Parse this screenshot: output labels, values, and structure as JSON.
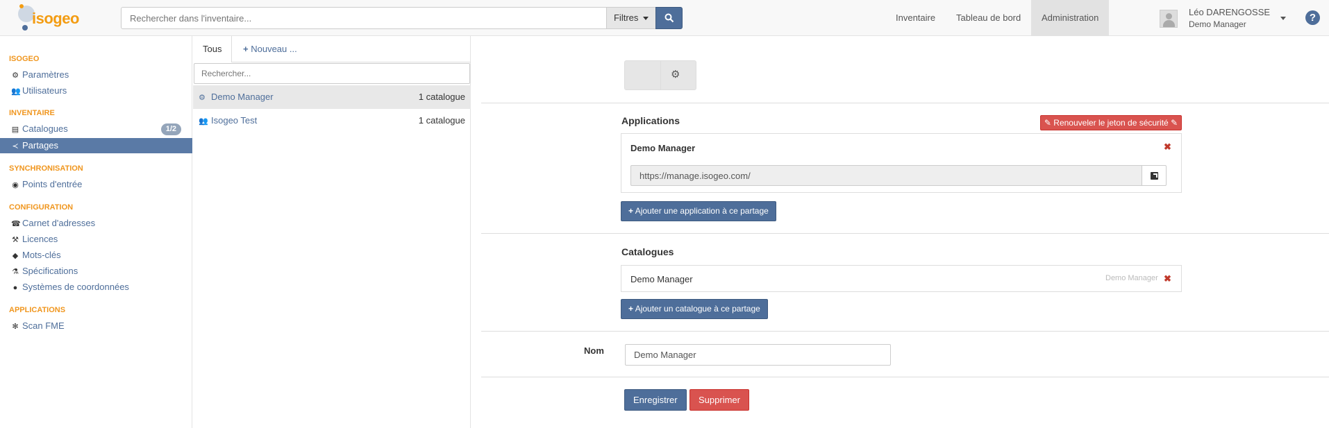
{
  "brand": {
    "logo_text": "isogeo"
  },
  "header": {
    "search_placeholder": "Rechercher dans l'inventaire...",
    "filters_label": "Filtres",
    "nav": [
      {
        "label": "Inventaire"
      },
      {
        "label": "Tableau de bord"
      },
      {
        "label": "Administration",
        "active": true
      }
    ],
    "user": {
      "name": "Léo DARENGOSSE",
      "org": "Demo Manager"
    },
    "help_label": "?"
  },
  "sidebar": {
    "sections": [
      {
        "title": "ISOGEO",
        "items": [
          {
            "label": "Paramètres",
            "icon": "gears-icon"
          },
          {
            "label": "Utilisateurs",
            "icon": "users-icon"
          }
        ]
      },
      {
        "title": "INVENTAIRE",
        "items": [
          {
            "label": "Catalogues",
            "icon": "book-icon",
            "badge": "1/2"
          },
          {
            "label": "Partages",
            "icon": "share-icon",
            "active": true
          }
        ]
      },
      {
        "title": "SYNCHRONISATION",
        "items": [
          {
            "label": "Points d'entrée",
            "icon": "eye-icon"
          }
        ]
      },
      {
        "title": "CONFIGURATION",
        "items": [
          {
            "label": "Carnet d'adresses",
            "icon": "phone-icon"
          },
          {
            "label": "Licences",
            "icon": "gavel-icon"
          },
          {
            "label": "Mots-clés",
            "icon": "tags-icon"
          },
          {
            "label": "Spécifications",
            "icon": "flask-icon"
          },
          {
            "label": "Systèmes de coordonnées",
            "icon": "globe-icon"
          }
        ]
      },
      {
        "title": "APPLICATIONS",
        "items": [
          {
            "label": "Scan FME",
            "icon": "gear-icon"
          }
        ]
      }
    ]
  },
  "shares_panel": {
    "tabs": {
      "all": "Tous",
      "new": "Nouveau ..."
    },
    "search_placeholder": "Rechercher...",
    "items": [
      {
        "name": "Demo Manager",
        "count": "1 catalogue",
        "icon": "gears-icon",
        "active": true
      },
      {
        "name": "Isogeo Test",
        "count": "1 catalogue",
        "icon": "users-icon"
      }
    ]
  },
  "detail": {
    "applications_title": "Applications",
    "renew_token_label": "Renouveler le jeton de sécurité",
    "application": {
      "name": "Demo Manager",
      "url": "https://manage.isogeo.com/"
    },
    "add_application_label": "Ajouter une application à ce partage",
    "catalogs_title": "Catalogues",
    "catalog": {
      "name": "Demo Manager",
      "owner": "Demo Manager"
    },
    "add_catalog_label": "Ajouter un catalogue à ce partage",
    "name_label": "Nom",
    "name_value": "Demo Manager",
    "save_label": "Enregistrer",
    "delete_label": "Supprimer"
  },
  "colors": {
    "accent": "#4e6e9a",
    "brand_orange": "#f39c12",
    "danger": "#d9534f"
  }
}
